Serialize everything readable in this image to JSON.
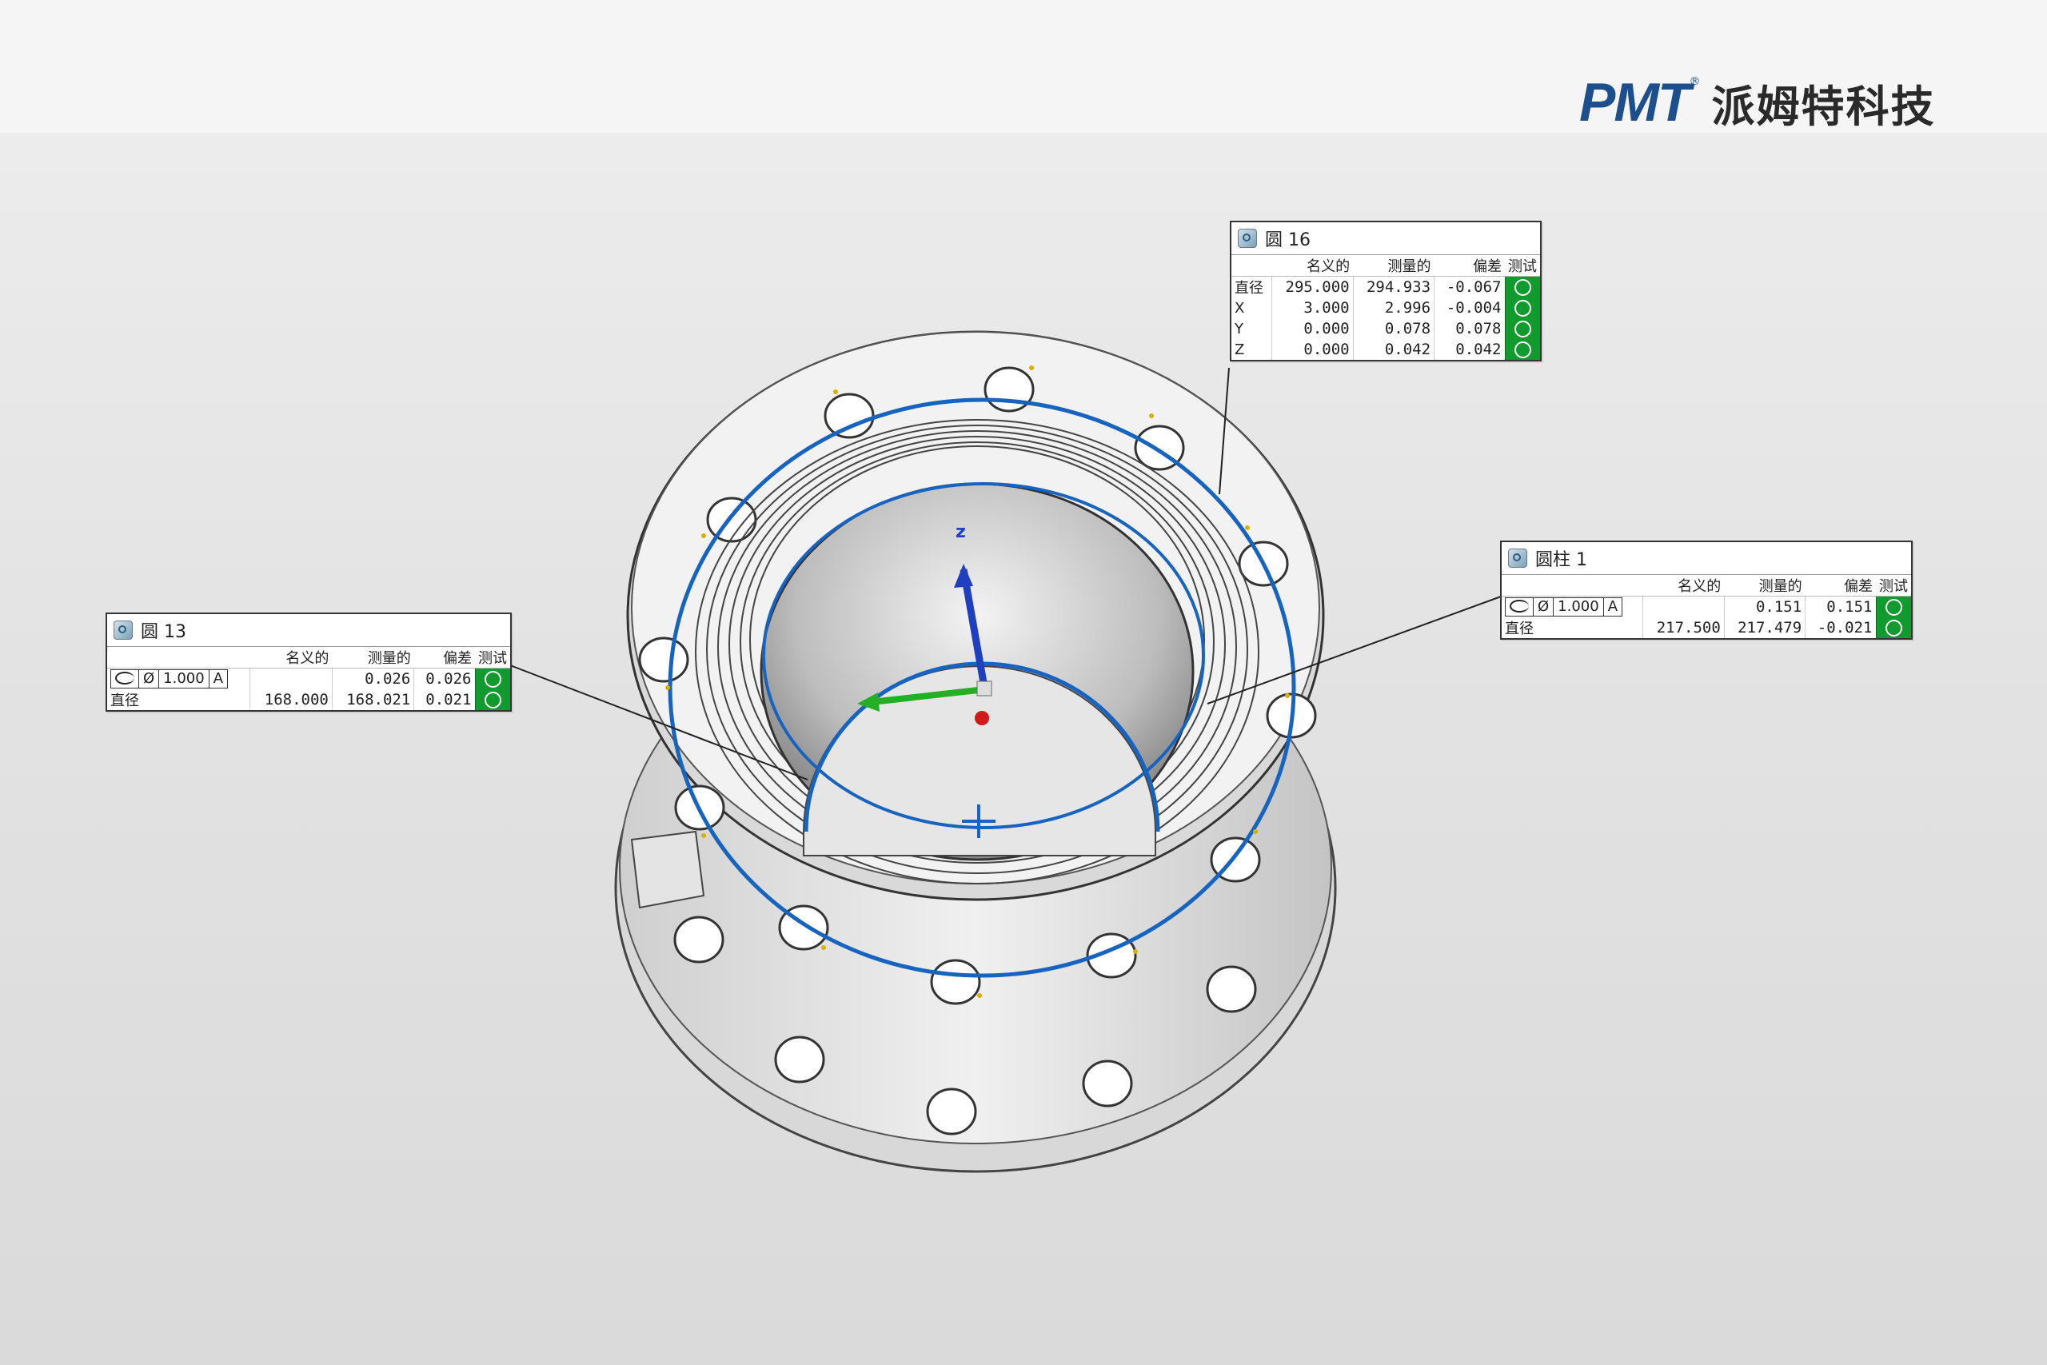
{
  "brand": {
    "logo_mark": "PMT",
    "logo_reg": "®",
    "company_cn": "派姆特科技",
    "primary_color": "#1d4f8c"
  },
  "viewport": {
    "axis_z_label": "z",
    "axis_colors": {
      "x": "#d11a1a",
      "y": "#24b024",
      "z": "#1e3fbf"
    },
    "fit_circle_color": "#1764c0"
  },
  "panels": {
    "circle16": {
      "icon": "circle-feature-icon",
      "title": "圆 16",
      "headers": [
        "",
        "名义的",
        "测量的",
        "偏差",
        "测试"
      ],
      "rows": [
        {
          "label": "直径",
          "nominal": "295.000",
          "measured": "294.933",
          "deviation": "-0.067"
        },
        {
          "label": "X",
          "nominal": "3.000",
          "measured": "2.996",
          "deviation": "-0.004"
        },
        {
          "label": "Y",
          "nominal": "0.000",
          "measured": "0.078",
          "deviation": "0.078"
        },
        {
          "label": "Z",
          "nominal": "0.000",
          "measured": "0.042",
          "deviation": "0.042"
        }
      ]
    },
    "cylinder1": {
      "icon": "cylinder-feature-icon",
      "title": "圆柱 1",
      "headers": [
        "",
        "名义的",
        "测量的",
        "偏差",
        "测试"
      ],
      "fcf": {
        "symbol": "position-icon",
        "diameter": "Ø",
        "tolerance": "1.000",
        "datum": "A"
      },
      "rows": [
        {
          "label": "",
          "nominal": "",
          "measured": "0.151",
          "deviation": "0.151"
        },
        {
          "label": "直径",
          "nominal": "217.500",
          "measured": "217.479",
          "deviation": "-0.021"
        }
      ]
    },
    "circle13": {
      "icon": "circle-feature-icon",
      "title": "圆 13",
      "headers": [
        "",
        "名义的",
        "测量的",
        "偏差",
        "测试"
      ],
      "fcf": {
        "symbol": "position-icon",
        "diameter": "Ø",
        "tolerance": "1.000",
        "datum": "A"
      },
      "rows": [
        {
          "label": "",
          "nominal": "",
          "measured": "0.026",
          "deviation": "0.026"
        },
        {
          "label": "直径",
          "nominal": "168.000",
          "measured": "168.021",
          "deviation": "0.021"
        }
      ]
    }
  }
}
